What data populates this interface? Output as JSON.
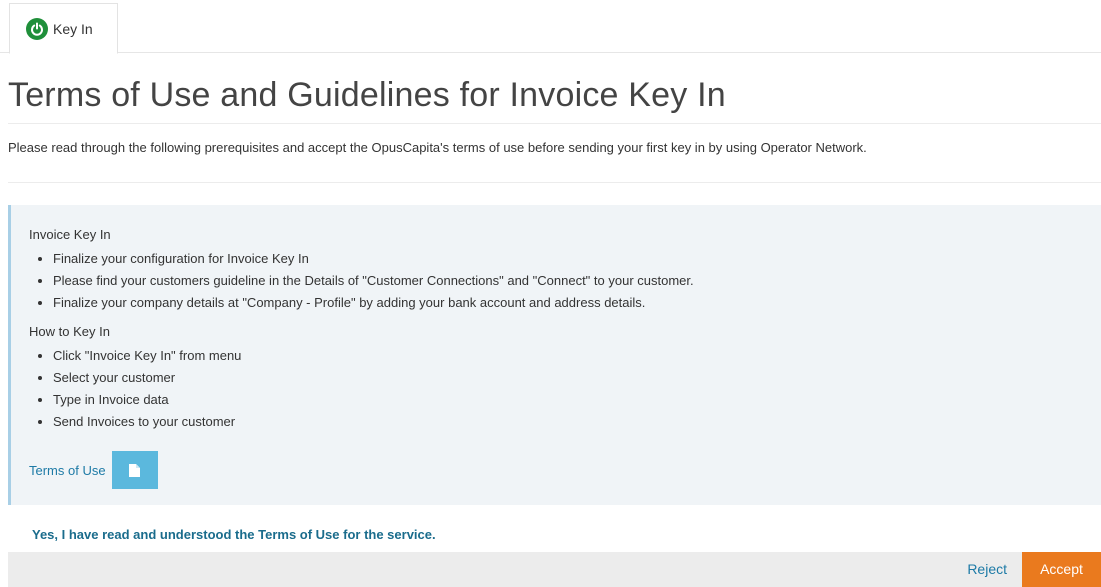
{
  "tab": {
    "label": "Key In",
    "icon": "power-icon",
    "icon_color": "#1f8f3a"
  },
  "page": {
    "title": "Terms of Use and Guidelines for Invoice Key In",
    "intro": "Please read through the following prerequisites and accept the OpusCapita's terms of use before sending your first key in by using Operator Network."
  },
  "info": {
    "sections": [
      {
        "title": "Invoice Key In",
        "items": [
          "Finalize your configuration for Invoice Key In",
          "Please find your customers guideline in the Details of \"Customer Connections\" and \"Connect\" to your customer.",
          "Finalize your company details at \"Company - Profile\" by adding your bank account and address details."
        ]
      },
      {
        "title": "How to Key In",
        "items": [
          "Click \"Invoice Key In\" from menu",
          "Select your customer",
          "Type in Invoice data",
          "Send Invoices to your customer"
        ]
      }
    ],
    "terms_link": "Terms of Use",
    "terms_button_icon": "document-icon"
  },
  "confirmation": {
    "text": "Yes, I have read and understood the Terms of Use for the service."
  },
  "footer": {
    "reject_label": "Reject",
    "accept_label": "Accept",
    "accept_color": "#ea7a1e"
  }
}
